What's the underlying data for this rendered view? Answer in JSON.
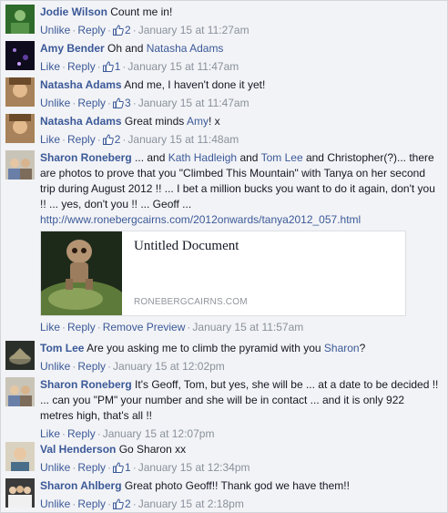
{
  "comments": [
    {
      "name": "Jodie Wilson",
      "text": " Count me in!",
      "actions": [
        "Unlike",
        "Reply"
      ],
      "likes": "2",
      "time": "January 15 at 11:27am"
    },
    {
      "name": "Amy Bender",
      "text_parts": [
        " Oh and ",
        "Natasha Adams"
      ],
      "actions": [
        "Like",
        "Reply"
      ],
      "likes": "1",
      "time": "January 15 at 11:47am"
    },
    {
      "name": "Natasha Adams",
      "text": " And me, I haven't done it yet!",
      "actions": [
        "Unlike",
        "Reply"
      ],
      "likes": "3",
      "time": "January 15 at 11:47am"
    },
    {
      "name": "Natasha Adams",
      "text_parts": [
        " Great minds ",
        "Amy",
        "! x"
      ],
      "actions": [
        "Like",
        "Reply"
      ],
      "likes": "2",
      "time": "January 15 at 11:48am"
    },
    {
      "name": "Sharon Roneberg",
      "text_parts": [
        " ... and ",
        "Kath Hadleigh",
        " and ",
        "Tom Lee",
        " and Christopher(?)... there are photos to prove that you \"Climbed This Mountain\" with Tanya on her second trip during August 2012 !! ... I bet a million bucks you want to do it again, don't you !! ... yes, don't you !! ... Geoff ..."
      ],
      "url": "http://www.ronebergcairns.com/2012onwards/tanya2012_057.html",
      "actions": [
        "Like",
        "Reply",
        "Remove Preview"
      ],
      "time": "January 15 at 11:57am",
      "preview": {
        "title": "Untitled Document",
        "domain": "RONEBERGCAIRNS.COM"
      }
    },
    {
      "name": "Tom Lee",
      "text_parts": [
        " Are you asking me to climb the pyramid with you ",
        "Sharon",
        "?"
      ],
      "actions": [
        "Unlike",
        "Reply"
      ],
      "time": "January 15 at 12:02pm"
    },
    {
      "name": "Sharon Roneberg",
      "text": " It's Geoff, Tom, but yes, she will be ... at a date to be decided !! ... can you \"PM\" your number and she will be in contact ... and it is only 922 metres high, that's all !!",
      "actions": [
        "Like",
        "Reply"
      ],
      "time": "January 15 at 12:07pm"
    },
    {
      "name": "Val Henderson",
      "text": " Go Sharon xx",
      "actions": [
        "Unlike",
        "Reply"
      ],
      "likes": "1",
      "time": "January 15 at 12:34pm"
    },
    {
      "name": "Sharon Ahlberg",
      "text": " Great photo Geoff!! Thank god we have them!!",
      "actions": [
        "Unlike",
        "Reply"
      ],
      "likes": "2",
      "time": "January 15 at 2:18pm"
    }
  ],
  "colors": {
    "link": "#3b5998",
    "meta": "#89919c",
    "background": "#f2f3f6"
  },
  "icons": {
    "like": "thumbs-up-icon"
  }
}
